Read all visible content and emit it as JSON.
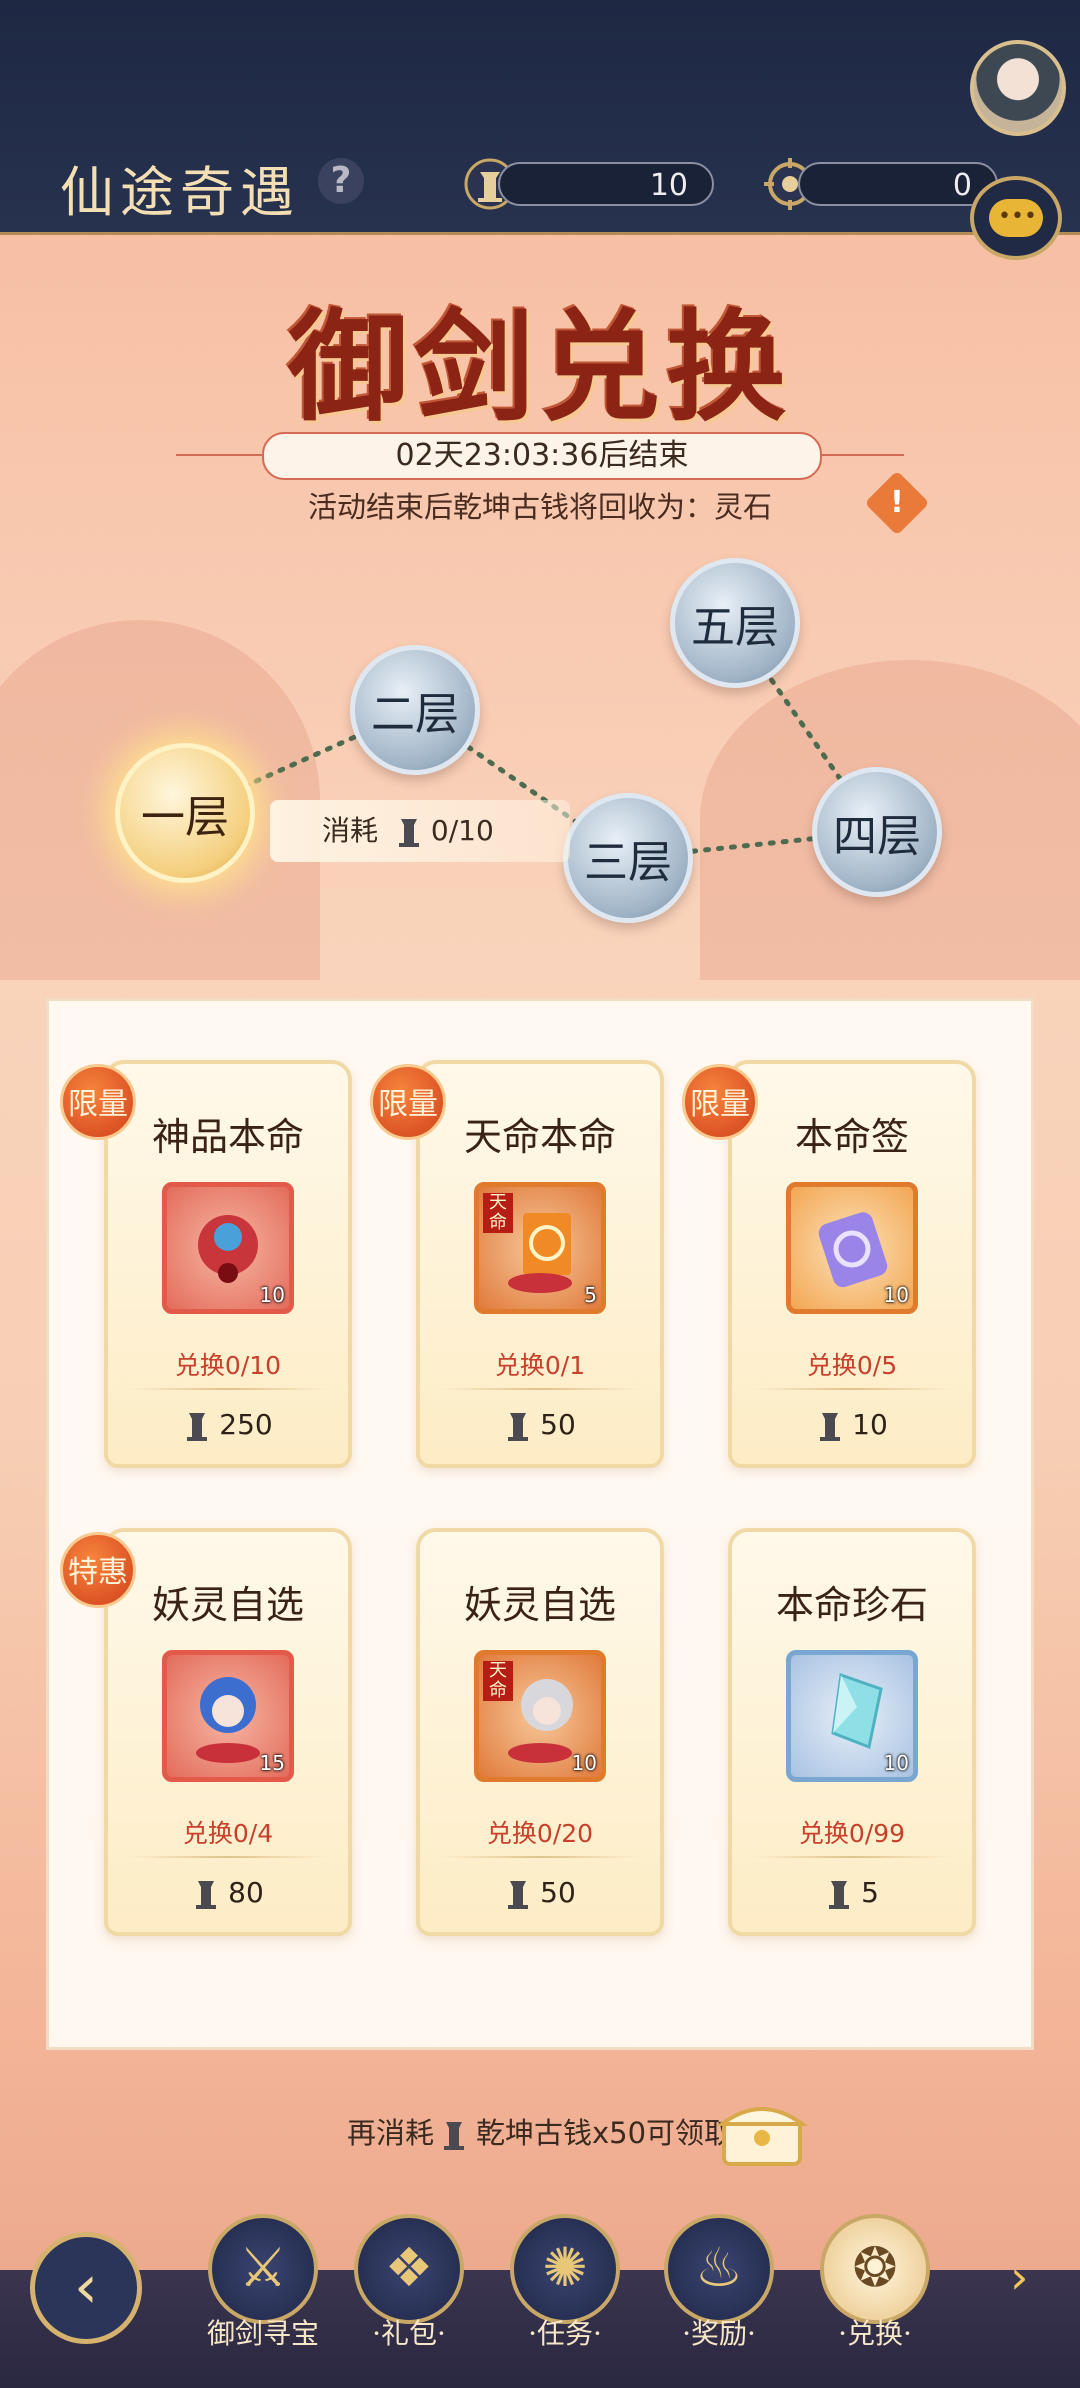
{
  "header": {
    "title": "仙途奇遇",
    "help_icon": "?",
    "currency1": {
      "icon": "coin-figure-icon",
      "value": "10"
    },
    "currency2": {
      "icon": "compass-token-icon",
      "value": "0"
    }
  },
  "event": {
    "title": "御剑兑换",
    "countdown": "02天23:03:36后结束",
    "notice": "活动结束后乾坤古钱将回收为：灵石",
    "warn_symbol": "!"
  },
  "floors": {
    "items": [
      "一层",
      "二层",
      "三层",
      "四层",
      "五层"
    ],
    "active_index": 0,
    "consume_label": "消耗",
    "consume_value": "0/10"
  },
  "shop": {
    "items": [
      {
        "badge": "限量",
        "name": "神品本命",
        "qty": "10",
        "exchange": "兑换0/10",
        "price": "250",
        "tag": ""
      },
      {
        "badge": "限量",
        "name": "天命本命",
        "qty": "5",
        "exchange": "兑换0/1",
        "price": "50",
        "tag": "天命"
      },
      {
        "badge": "限量",
        "name": "本命签",
        "qty": "10",
        "exchange": "兑换0/5",
        "price": "10",
        "tag": ""
      },
      {
        "badge": "特惠",
        "name": "妖灵自选",
        "qty": "15",
        "exchange": "兑换0/4",
        "price": "80",
        "tag": ""
      },
      {
        "badge": "",
        "name": "妖灵自选",
        "qty": "10",
        "exchange": "兑换0/20",
        "price": "50",
        "tag": "天命"
      },
      {
        "badge": "",
        "name": "本命珍石",
        "qty": "10",
        "exchange": "兑换0/99",
        "price": "5",
        "tag": ""
      }
    ]
  },
  "claim": {
    "prefix": "再消耗",
    "text": "乾坤古钱x50可领取"
  },
  "nav": {
    "back_icon": "‹",
    "items": [
      {
        "label": "御剑寻宝",
        "icon": "sword-icon",
        "glyph": "⚔"
      },
      {
        "label": "·礼包·",
        "icon": "gift-icon",
        "glyph": "❖"
      },
      {
        "label": "·任务·",
        "icon": "task-icon",
        "glyph": "✺"
      },
      {
        "label": "·奖励·",
        "icon": "reward-icon",
        "glyph": "♨"
      },
      {
        "label": "·兑换·",
        "icon": "exchange-icon",
        "glyph": "❂"
      }
    ],
    "more_icon": "›"
  },
  "colors": {
    "header_bg": "#222c48",
    "accent_red": "#c7402b",
    "gold": "#d5b26d"
  }
}
